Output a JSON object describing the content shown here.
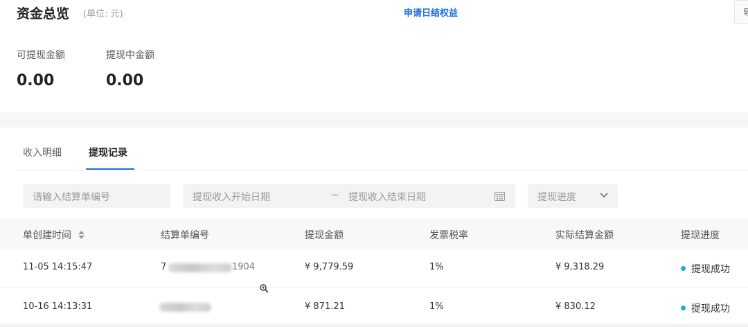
{
  "overview": {
    "title": "资金总览",
    "unit": "(单位: 元)",
    "apply_link": "申请日结权益",
    "edge_button": "导",
    "stats": [
      {
        "label": "可提现金额",
        "value": "0.00"
      },
      {
        "label": "提现中金额",
        "value": "0.00"
      }
    ]
  },
  "tabs": [
    {
      "label": "收入明细",
      "active": false
    },
    {
      "label": "提现记录",
      "active": true
    }
  ],
  "filters": {
    "statement_no_placeholder": "请输入结算单编号",
    "start_date_placeholder": "提现收入开始日期",
    "range_separator": "~",
    "end_date_placeholder": "提现收入结束日期",
    "progress_placeholder": "提现进度"
  },
  "table": {
    "columns": [
      "单创建时间",
      "结算单编号",
      "提现金额",
      "发票税率",
      "实际结算金额",
      "提现进度"
    ],
    "rows": [
      {
        "created": "11-05 14:15:47",
        "statement_prefix": "7",
        "statement_suffix": "1904",
        "amount": "¥ 9,779.59",
        "tax_rate": "1%",
        "actual": "¥ 9,318.29",
        "status": "提现成功"
      },
      {
        "created": "10-16 14:13:31",
        "amount": "¥ 871.21",
        "tax_rate": "1%",
        "actual": "¥ 830.12",
        "status": "提现成功"
      }
    ]
  },
  "colors": {
    "accent": "#1f6fe0",
    "success_dot": "#1fa8d8"
  }
}
